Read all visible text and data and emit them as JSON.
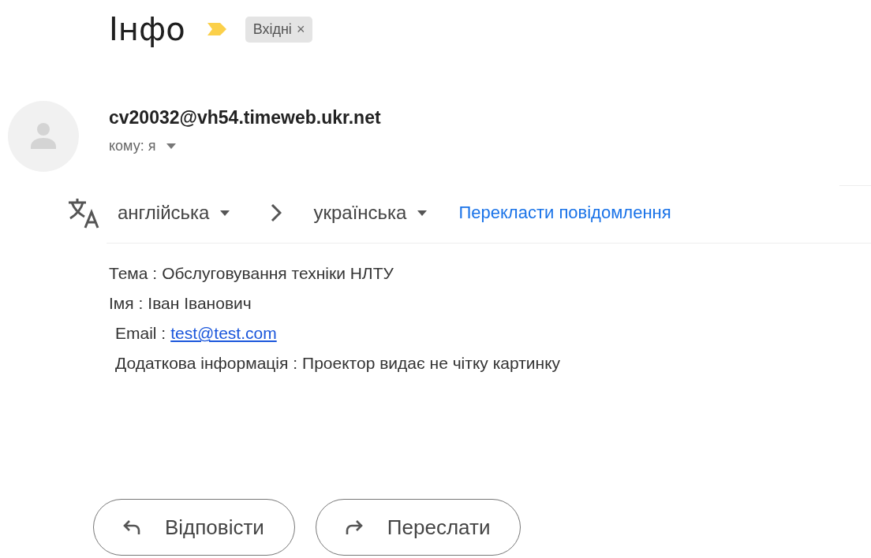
{
  "subject": "Інфо",
  "important": true,
  "labels": [
    {
      "text": "Вхідні",
      "remove": "×"
    }
  ],
  "sender": {
    "address": "cv20032@vh54.timeweb.ukr.net",
    "recipient": "кому: я"
  },
  "translate": {
    "from": "англійська",
    "to": "українська",
    "action": "Перекласти повідомлення"
  },
  "body": [
    {
      "label": "Тема :",
      "value": "Обслуговування техніки НЛТУ",
      "kind": "text",
      "indent": false
    },
    {
      "label": "Імя :",
      "value": "Іван Іванович",
      "kind": "text",
      "indent": false
    },
    {
      "label": "Email :",
      "value": "test@test.com",
      "kind": "link",
      "indent": true
    },
    {
      "label": "Додаткова інформація :",
      "value": "Проектор видає не чітку картинку",
      "kind": "text",
      "indent": true
    }
  ],
  "buttons": [
    {
      "label": "Відповісти",
      "kind": "reply"
    },
    {
      "label": "Переслати",
      "kind": "forward"
    }
  ]
}
